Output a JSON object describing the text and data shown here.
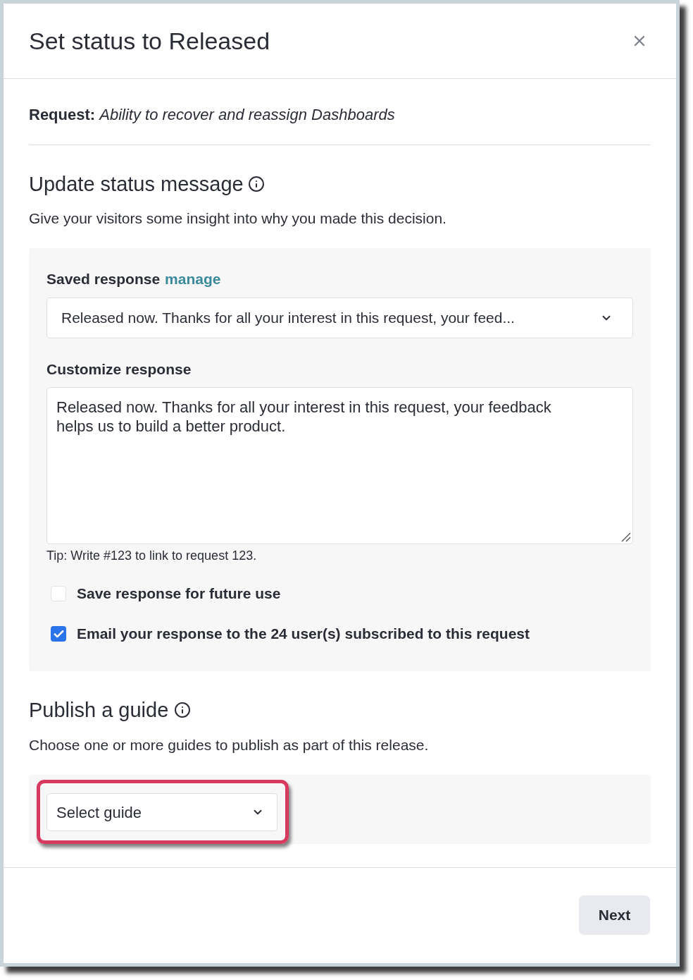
{
  "dialog": {
    "title": "Set status to Released"
  },
  "request": "**Request:** *Ability to recover and reassign Dashboards*",
  "status_section": {
    "heading": "Update status message",
    "description": "Give your visitors some insight into why you made this decision.",
    "saved_response": {
      "label": "Saved response",
      "link": "manage",
      "value": "Released now. Thanks for all your interest in this request, your feed..."
    },
    "customize": {
      "label": "Customize response",
      "value": "Released now. Thanks for all your interest in this request, your feedback helps us to build a better product."
    },
    "tip": "Tip: Write #123 to link to request 123.",
    "options": [
      {
        "label": "Save response for future use",
        "checked": false
      },
      {
        "label": "Email your response to the 24 user(s) subscribed to this request",
        "checked": true
      }
    ]
  },
  "guide_section": {
    "heading": "Publish a guide",
    "description": "Choose one or more guides to publish as part of this release.",
    "select": {
      "placeholder": "Select guide",
      "highlighted": true
    }
  },
  "footer": {
    "buttons": [
      {
        "label": "Next"
      }
    ]
  }
}
